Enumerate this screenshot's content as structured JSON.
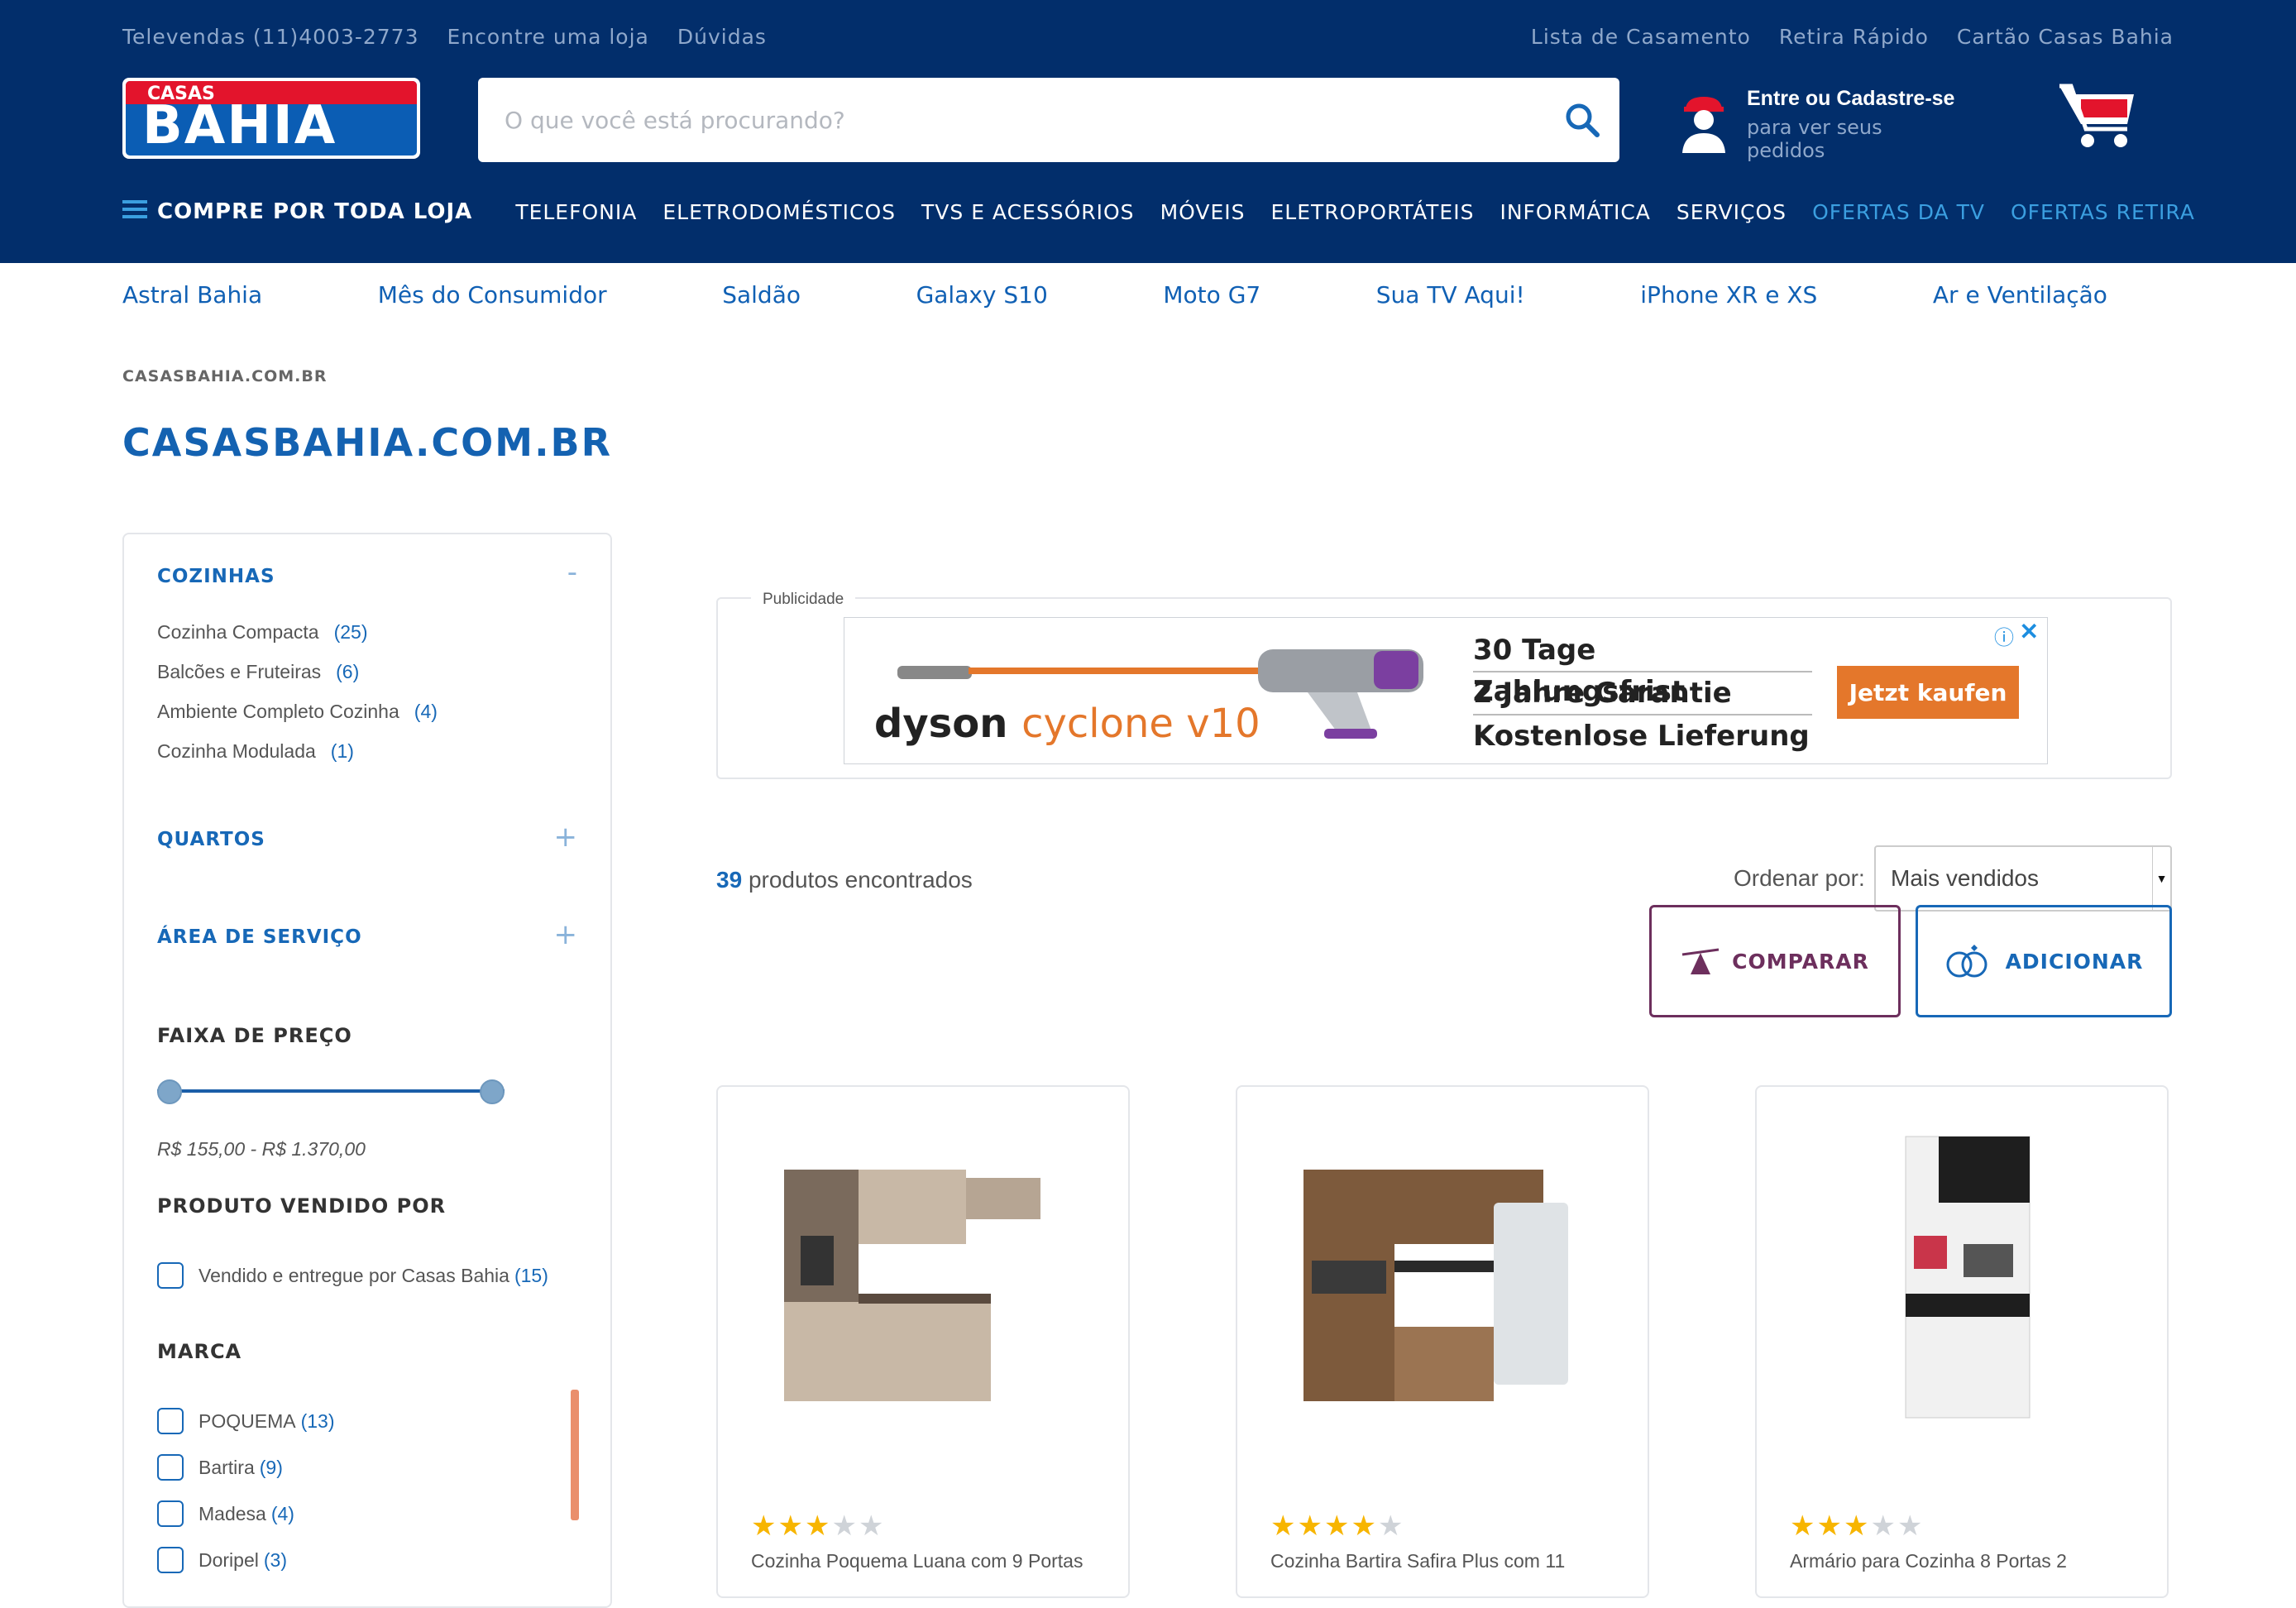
{
  "topbar": {
    "left": [
      "Televendas (11)4003-2773",
      "Encontre uma loja",
      "Dúvidas"
    ],
    "right": [
      "Lista de Casamento",
      "Retira Rápido",
      "Cartão Casas Bahia"
    ]
  },
  "logo": {
    "small": "CASAS",
    "big": "BAHIA"
  },
  "search": {
    "placeholder": "O que você está procurando?"
  },
  "account": {
    "title": "Entre ou Cadastre-se",
    "subtitle": "para ver seus pedidos"
  },
  "nav": {
    "all": "COMPRE POR TODA LOJA",
    "items": [
      "TELEFONIA",
      "ELETRODOMÉSTICOS",
      "TVS E ACESSÓRIOS",
      "MÓVEIS",
      "ELETROPORTÁTEIS",
      "INFORMÁTICA",
      "SERVIÇOS",
      "OFERTAS DA TV",
      "OFERTAS RETIRA"
    ]
  },
  "quicklinks": [
    "Astral Bahia",
    "Mês do Consumidor",
    "Saldão",
    "Galaxy S10",
    "Moto G7",
    "Sua TV Aqui!",
    "iPhone XR e XS",
    "Ar e Ventilação"
  ],
  "breadcrumb": "CASASBAHIA.COM.BR",
  "page_title": "CASASBAHIA.COM.BR",
  "sidebar": {
    "cozinhas": {
      "title": "COZINHAS",
      "toggle": "-",
      "items": [
        {
          "label": "Cozinha Compacta",
          "count": "(25)"
        },
        {
          "label": "Balcões e Fruteiras",
          "count": "(6)"
        },
        {
          "label": "Ambiente Completo Cozinha",
          "count": "(4)"
        },
        {
          "label": "Cozinha Modulada",
          "count": "(1)"
        }
      ]
    },
    "quartos": {
      "title": "QUARTOS",
      "toggle": "+"
    },
    "area": {
      "title": "ÁREA DE SERVIÇO",
      "toggle": "+"
    },
    "price": {
      "title": "FAIXA DE PREÇO",
      "range": "R$ 155,00 - R$ 1.370,00",
      "min_fraction": 0,
      "max_fraction": 1
    },
    "seller": {
      "title": "PRODUTO VENDIDO POR",
      "label": "Vendido e entregue por Casas Bahia",
      "count": "(15)"
    },
    "brand": {
      "title": "MARCA",
      "items": [
        {
          "label": "POQUEMA",
          "count": "(13)"
        },
        {
          "label": "Bartira",
          "count": "(9)"
        },
        {
          "label": "Madesa",
          "count": "(4)"
        },
        {
          "label": "Doripel",
          "count": "(3)"
        }
      ]
    }
  },
  "ad": {
    "label": "Publicidade",
    "brand": "dyson",
    "model": "cyclone v10",
    "claims": [
      "30 Tage Zahlungsfrist",
      "2 Jahre Garantie",
      "Kostenlose Lieferung"
    ],
    "cta": "Jetzt kaufen",
    "close": "✕",
    "adchoice": "ⓘ"
  },
  "results": {
    "count": "39",
    "label": "produtos encontrados"
  },
  "sort": {
    "label": "Ordenar por:",
    "value": "Mais vendidos"
  },
  "actions": {
    "compare": "COMPARAR",
    "add": "ADICIONAR"
  },
  "products": [
    {
      "name": "Cozinha Poquema Luana com 9 Portas",
      "rating": 3
    },
    {
      "name": "Cozinha Bartira Safira Plus com 11",
      "rating": 4
    },
    {
      "name": "Armário para Cozinha 8 Portas 2",
      "rating": 3
    }
  ],
  "colors": {
    "header_bg": "#022e6b",
    "accent_blue": "#1768b7",
    "highlight": "#3b9fe0",
    "compare": "#6d2f5d",
    "star": "#f7b500"
  }
}
